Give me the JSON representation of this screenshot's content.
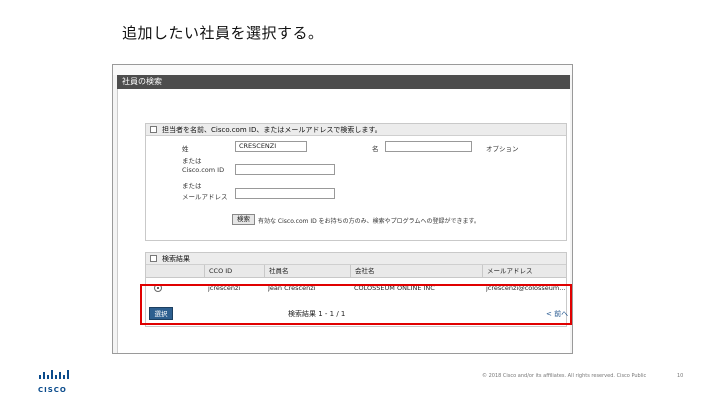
{
  "slide": {
    "title": "追加したい社員を選択する。",
    "footer": "© 2018 Cisco and/or its affiliates. All rights reserved.   Cisco Public",
    "page_number": "10",
    "logo_text": "CISCO",
    "accent_color": "#e00000"
  },
  "window": {
    "top_strip_text": "",
    "title": "社員の検索"
  },
  "search_section": {
    "header": "担当者を名前、Cisco.com ID、またはメールアドレスで検索します。",
    "last_name_label": "姓",
    "last_name_value": "CRESCENZI",
    "first_name_label": "名",
    "first_name_value": "",
    "option_label": "オプション",
    "ccoid_label_line1": "または",
    "ccoid_label_line2": "Cisco.com ID",
    "ccoid_value": "",
    "email_label_line1": "または",
    "email_label_line2": "メールアドレス",
    "email_value": "",
    "search_button": "検索",
    "note": "有効な Cisco.com ID をお持ちの方のみ、検索やプログラムへの登録ができます。"
  },
  "results_section": {
    "header": "検索結果",
    "columns": [
      "CCO ID",
      "社員名",
      "会社名",
      "メールアドレス"
    ],
    "rows": [
      {
        "cco_id": "jcrescenzi",
        "name": "Jean Crescenzi",
        "company": "COLOSSEUM ONLINE INC",
        "email": "jcrescenzi@colosseum..."
      }
    ],
    "select_button": "選択",
    "count_text": "検索結果 1 - 1 / 1",
    "prev_link": "< 前へ"
  }
}
